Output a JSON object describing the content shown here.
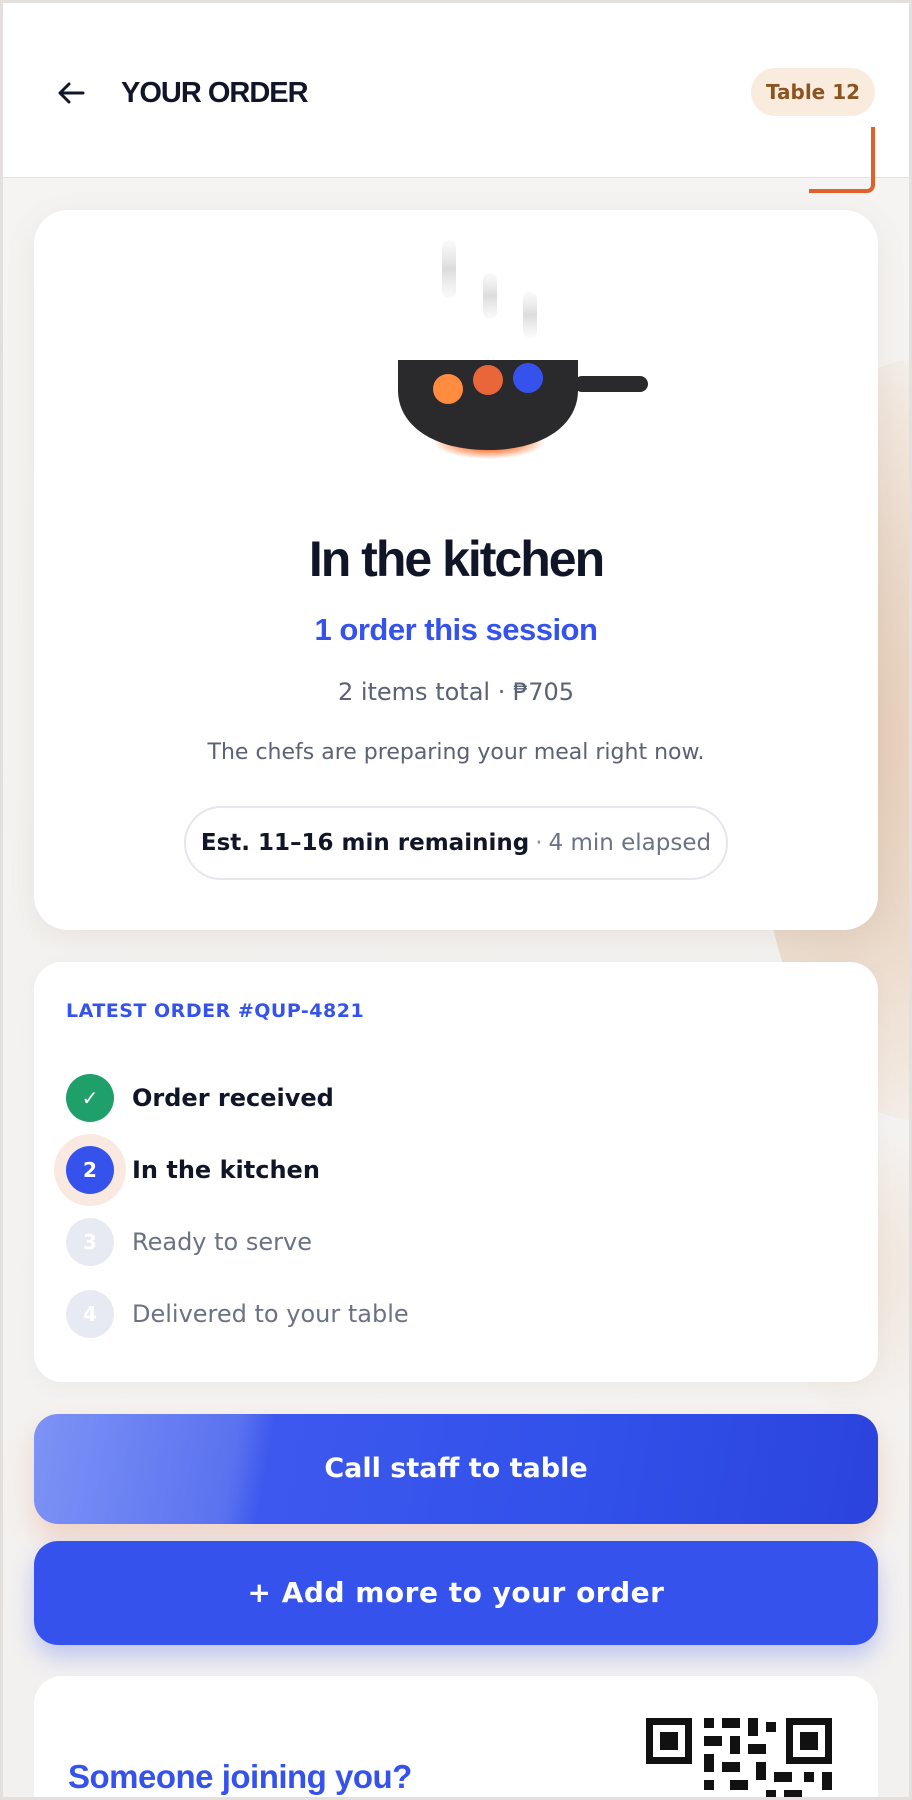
{
  "header": {
    "title": "YOUR ORDER",
    "table_badge": "Table 12",
    "back_icon": "arrow-left-icon"
  },
  "status": {
    "title": "In the kitchen",
    "session_count": "1 order this session",
    "items_total": "2 items total · ₱705",
    "description": "The chefs are preparing your meal right now.",
    "eta": "Est. 11–16 min remaining",
    "eta_separator": "·",
    "elapsed": "4 min elapsed",
    "illustration": "cooking-pan-icon"
  },
  "progress": {
    "label": "LATEST ORDER #QUP-4821",
    "steps": [
      {
        "marker": "✓",
        "label": "Order received",
        "state": "done"
      },
      {
        "marker": "2",
        "label": "In the kitchen",
        "state": "active"
      },
      {
        "marker": "3",
        "label": "Ready to serve",
        "state": "todo"
      },
      {
        "marker": "4",
        "label": "Delivered to your table",
        "state": "todo"
      }
    ]
  },
  "actions": {
    "call_staff": "Call staff to table",
    "add_more": "+ Add more to your order"
  },
  "share": {
    "title": "Someone joining you?",
    "qr_icon": "qr-code-icon"
  },
  "colors": {
    "accent": "#3553ec",
    "success": "#1fa06a",
    "brand_orange": "#e0612a",
    "badge_bg": "#f9ebde",
    "badge_text": "#8a5520"
  }
}
